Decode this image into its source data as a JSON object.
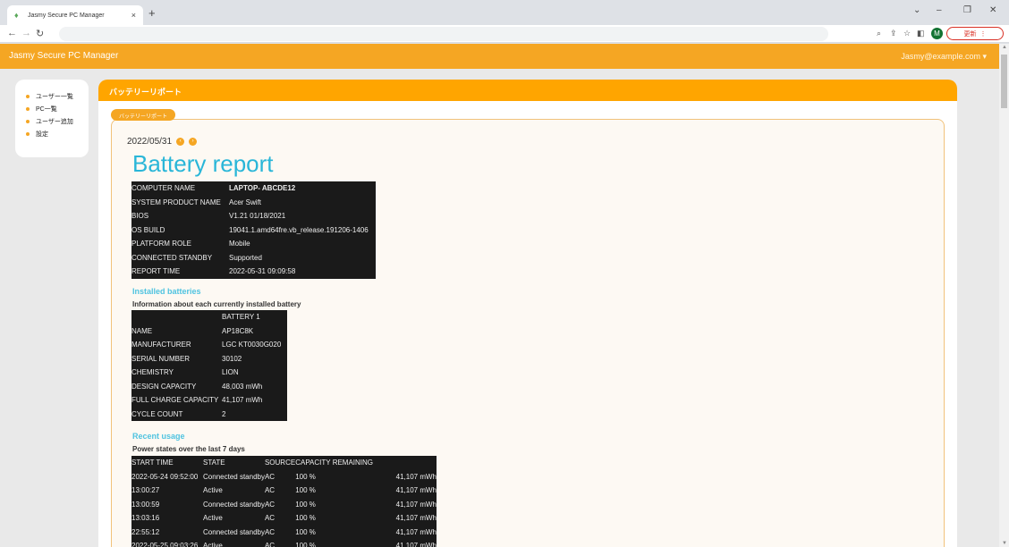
{
  "browser": {
    "tab_title": "Jasmy Secure PC Manager",
    "tab_close": "×",
    "new_tab": "+",
    "update_label": "更新",
    "avatar_initial": "M"
  },
  "app": {
    "title": "Jasmy Secure PC Manager",
    "user_menu": "Jasmy@example.com ▾"
  },
  "sidebar": {
    "items": [
      {
        "label": "ユーザー一覧"
      },
      {
        "label": "PC一覧"
      },
      {
        "label": "ユーザー追加"
      },
      {
        "label": "設定"
      }
    ]
  },
  "main": {
    "header": "バッテリーリポート",
    "badge": "バッテリーリポート",
    "date": "2022/05/31",
    "report_title": "Battery report"
  },
  "system_info": {
    "rows": [
      [
        "COMPUTER NAME",
        "LAPTOP- ABCDE12"
      ],
      [
        "SYSTEM PRODUCT NAME",
        "Acer Swift"
      ],
      [
        "BIOS",
        "V1.21 01/18/2021"
      ],
      [
        "OS BUILD",
        "19041.1.amd64fre.vb_release.191206-1406"
      ],
      [
        "PLATFORM ROLE",
        "Mobile"
      ],
      [
        "CONNECTED STANDBY",
        "Supported"
      ],
      [
        "REPORT TIME",
        "2022-05-31 09:09:58"
      ]
    ]
  },
  "installed_batteries": {
    "heading": "Installed batteries",
    "subheading": "Information about each currently installed battery",
    "column_header": "BATTERY 1",
    "rows": [
      [
        "NAME",
        "AP18C8K"
      ],
      [
        "MANUFACTURER",
        "LGC KT0030G020"
      ],
      [
        "SERIAL NUMBER",
        "30102"
      ],
      [
        "CHEMISTRY",
        "LION"
      ],
      [
        "DESIGN CAPACITY",
        "48,003 mWh"
      ],
      [
        "FULL CHARGE CAPACITY",
        "41,107 mWh"
      ],
      [
        "CYCLE COUNT",
        "2"
      ]
    ]
  },
  "recent_usage": {
    "heading": "Recent usage",
    "subheading": "Power states over the last 7 days",
    "columns": [
      "START TIME",
      "STATE",
      "SOURCE",
      "CAPACITY REMAINING",
      ""
    ],
    "rows": [
      [
        "2022-05-24 09:52:00",
        "Connected standby",
        "AC",
        "100 %",
        "41,107 mWh"
      ],
      [
        "13:00:27",
        "Active",
        "AC",
        "100 %",
        "41,107 mWh"
      ],
      [
        "13:00:59",
        "Connected standby",
        "AC",
        "100 %",
        "41,107 mWh"
      ],
      [
        "13:03:16",
        "Active",
        "AC",
        "100 %",
        "41,107 mWh"
      ],
      [
        "22:55:12",
        "Connected standby",
        "AC",
        "100 %",
        "41,107 mWh"
      ],
      [
        "2022-05-25 09:03:26",
        "Active",
        "AC",
        "100 %",
        "41,107 mWh"
      ]
    ]
  }
}
